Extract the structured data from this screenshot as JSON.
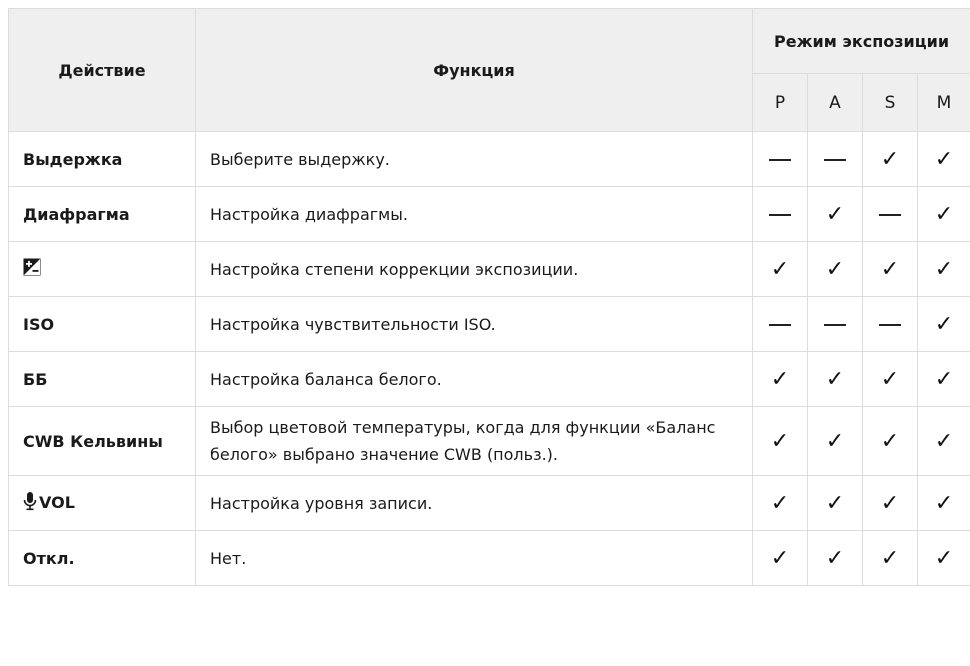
{
  "header": {
    "action": "Действие",
    "function": "Функция",
    "exposure_mode": "Режим экспозиции",
    "modes": [
      "P",
      "A",
      "S",
      "M"
    ]
  },
  "rows": [
    {
      "action": "Выдержка",
      "icon": "",
      "function": "Выберите выдержку.",
      "marks": [
        false,
        false,
        true,
        true
      ]
    },
    {
      "action": "Диафрагма",
      "icon": "",
      "function": "Настройка диафрагмы.",
      "marks": [
        false,
        true,
        false,
        true
      ]
    },
    {
      "action": "",
      "icon": "exposure-compensation-icon",
      "function": "Настройка степени коррекции экспозиции.",
      "marks": [
        true,
        true,
        true,
        true
      ]
    },
    {
      "action": "ISO",
      "icon": "",
      "function": "Настройка чувствительности ISO.",
      "marks": [
        false,
        false,
        false,
        true
      ]
    },
    {
      "action": "ББ",
      "icon": "",
      "function": "Настройка баланса белого.",
      "marks": [
        true,
        true,
        true,
        true
      ]
    },
    {
      "action": "CWB Кельвины",
      "icon": "",
      "function": "Выбор цветовой температуры, когда для функции «Баланс белого» выбрано значение CWB (польз.).",
      "marks": [
        true,
        true,
        true,
        true
      ]
    },
    {
      "action": "VOL",
      "icon": "microphone-icon",
      "function": "Настройка уровня записи.",
      "marks": [
        true,
        true,
        true,
        true
      ]
    },
    {
      "action": "Откл.",
      "icon": "",
      "function": "Нет.",
      "marks": [
        true,
        true,
        true,
        true
      ]
    }
  ],
  "symbols": {
    "check": "✓"
  }
}
